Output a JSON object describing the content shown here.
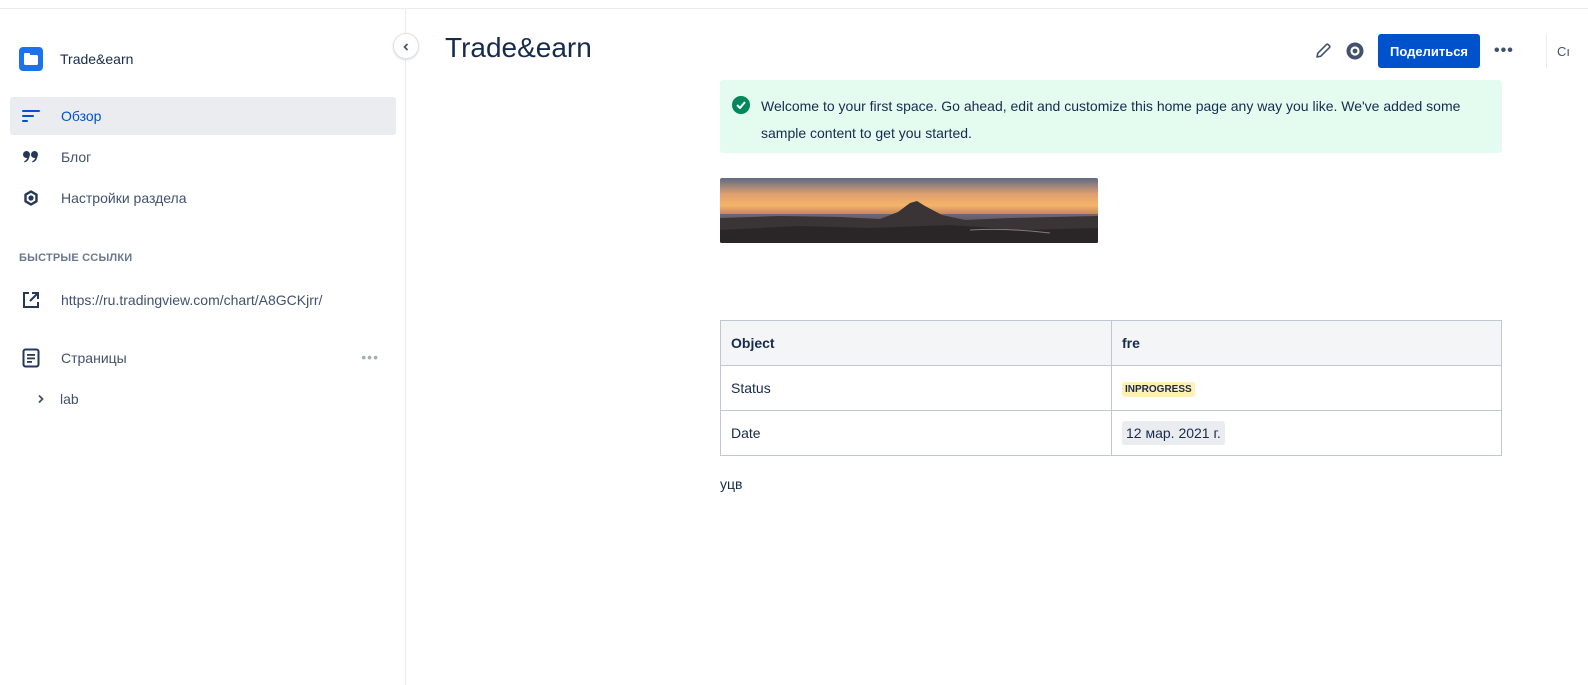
{
  "sidebar": {
    "space_name": "Trade&earn",
    "collapse_icon": "chevron-left-icon",
    "nav": [
      {
        "label": "Обзор",
        "icon": "overview-icon",
        "active": true
      },
      {
        "label": "Блог",
        "icon": "quote-icon",
        "active": false
      },
      {
        "label": "Настройки раздела",
        "icon": "gear-icon",
        "active": false
      }
    ],
    "quick_links_title": "БЫСТРЫЕ ССЫЛКИ",
    "quick_links": [
      {
        "label": "https://ru.tradingview.com/chart/A8GCKjrr/",
        "icon": "external-link-icon"
      }
    ],
    "pages_label": "Страницы",
    "pages_more": "•••",
    "tree": [
      {
        "label": "lab",
        "icon": "chevron-right-icon"
      }
    ]
  },
  "main": {
    "title": "Trade&earn",
    "toolbar": {
      "edit_icon": "pencil-icon",
      "watch_icon": "eye-icon",
      "share_label": "Поделиться",
      "more_label": "•••",
      "cut_label": "Cı"
    },
    "info_panel": {
      "icon": "check-circle-icon",
      "text": "Welcome to your first space. Go ahead, edit and customize this home page any way you like. We've added some sample content to get you started."
    },
    "banner_image": "mountain-sunset-image",
    "table": {
      "headers": [
        "Object",
        "fre"
      ],
      "rows": [
        {
          "label": "Status",
          "value": "INPROGRESS"
        },
        {
          "label": "Date",
          "value": "12 мар. 2021 г."
        }
      ]
    },
    "footer_text": "уцв"
  },
  "colors": {
    "accent": "#0052cc",
    "space_avatar": "#1a73e8",
    "success_bg": "#e3fcef",
    "success_icon": "#00875a",
    "status_yellow": "#fff0b3"
  }
}
